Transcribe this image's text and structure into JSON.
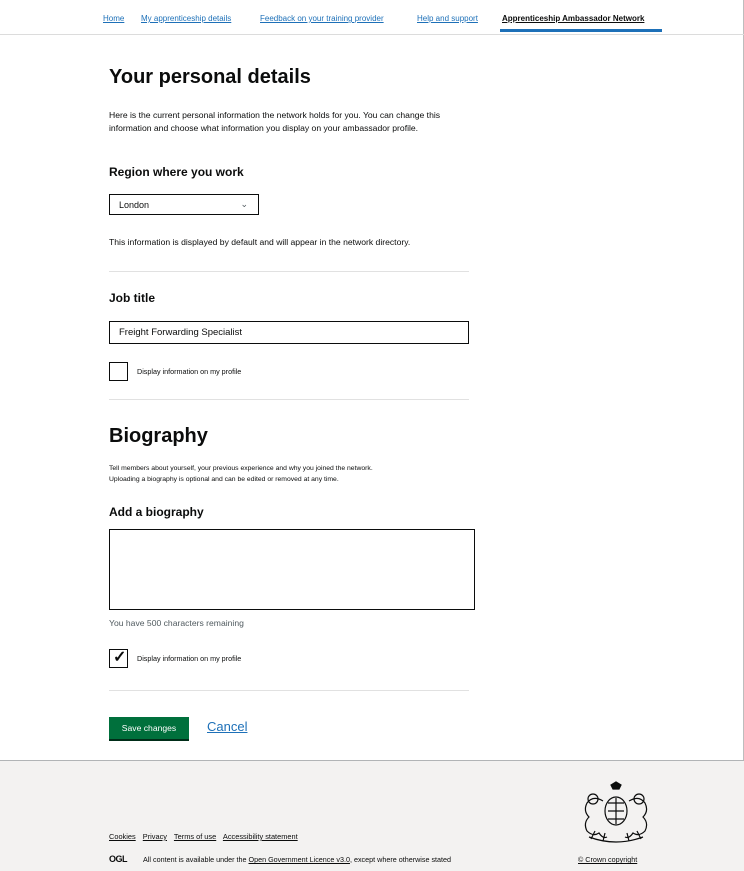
{
  "nav": {
    "items": [
      {
        "label": "Home"
      },
      {
        "label": "My apprenticeship details"
      },
      {
        "label": "Feedback on your training provider"
      },
      {
        "label": "Help and support"
      },
      {
        "label": "Apprenticeship Ambassador Network"
      }
    ]
  },
  "page": {
    "title": "Your personal details",
    "intro": "Here is the current personal information the network holds for you. You can change this information and choose what information you display on your ambassador profile."
  },
  "region": {
    "label": "Region where you work",
    "selected": "London",
    "info": "This information is displayed by default and will appear in the network directory."
  },
  "job": {
    "label": "Job title",
    "value": "Freight Forwarding Specialist",
    "display_label": "Display information on my profile",
    "display_checked": false
  },
  "biography": {
    "heading": "Biography",
    "intro_line1": "Tell members about yourself, your previous experience and why you joined the network.",
    "intro_line2": "Uploading a biography is optional and can be edited or removed at any time.",
    "label": "Add a biography",
    "value": "",
    "remaining": "You have 500 characters remaining",
    "display_label": "Display information on my profile",
    "display_checked": true
  },
  "actions": {
    "save": "Save changes",
    "cancel": "Cancel"
  },
  "footer": {
    "links": [
      {
        "label": "Cookies"
      },
      {
        "label": "Privacy"
      },
      {
        "label": "Terms of use"
      },
      {
        "label": "Accessibility statement"
      }
    ],
    "ogl": "OGL",
    "licence_prefix": "All content is available under the ",
    "licence_link": "Open Government Licence v3.0",
    "licence_suffix": ", except where otherwise stated",
    "copyright": "© Crown copyright"
  },
  "colors": {
    "link": "#1d70b8",
    "button": "#00703c",
    "text": "#0b0c0c",
    "footer_bg": "#f3f2f1"
  },
  "icons": {
    "select": "chevron-down-icon",
    "checkbox": "checkmark-icon",
    "crest": "royal-coat-of-arms-icon"
  }
}
